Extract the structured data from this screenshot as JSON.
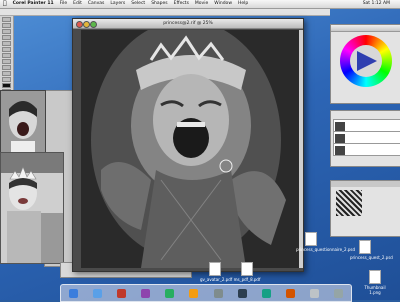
{
  "menubar": {
    "app": "Corel Painter 11",
    "items": [
      "File",
      "Edit",
      "Canvas",
      "Layers",
      "Select",
      "Shapes",
      "Effects",
      "Movie",
      "Window",
      "Help"
    ],
    "clock": "Sat 1:12 AM"
  },
  "document": {
    "title": "princess@2.rif @ 25%"
  },
  "desktop_icons": [
    {
      "label": "princess_questionnaire_2.psd"
    },
    {
      "label": "princess_quest_2.psd"
    },
    {
      "label": "gv_avatar_2.pdf"
    },
    {
      "label": "ms_pdf_8.pdf"
    },
    {
      "label": "Thumbnail 1.png"
    }
  ],
  "colors": {
    "desktop": "#2d66b6",
    "accent": "#4f8fd6"
  }
}
